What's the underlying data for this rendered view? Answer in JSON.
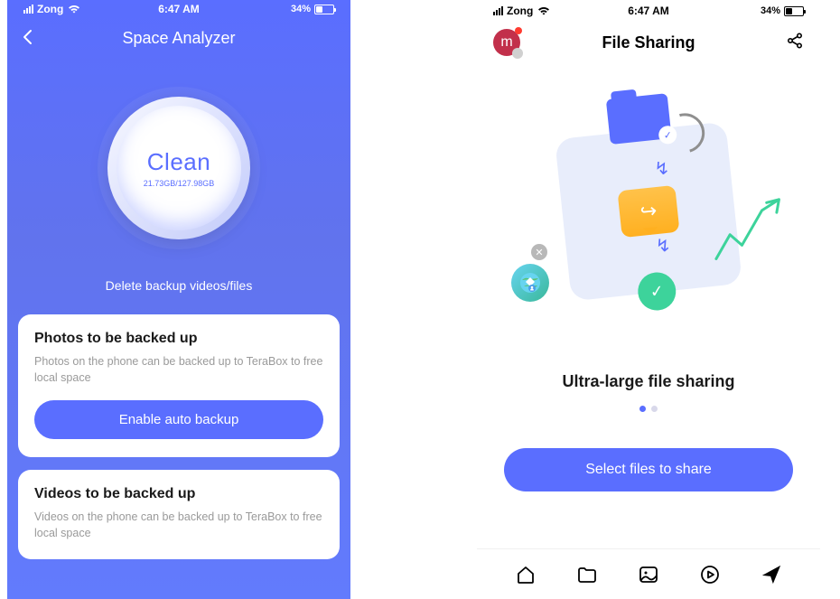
{
  "status": {
    "carrier": "Zong",
    "time": "6:47 AM",
    "battery_pct": "34%"
  },
  "left_screen": {
    "title": "Space Analyzer",
    "clean_label": "Clean",
    "storage": "21.73GB/127.98GB",
    "delete_text": "Delete backup videos/files",
    "cards": [
      {
        "title": "Photos to be backed up",
        "desc": "Photos on the phone can be backed up to TeraBox to free local space",
        "button": "Enable auto backup"
      },
      {
        "title": "Videos to be backed up",
        "desc": "Videos on the phone can be backed up to TeraBox to free local space"
      }
    ]
  },
  "right_screen": {
    "title": "File Sharing",
    "avatar_letter": "m",
    "headline": "Ultra-large file sharing",
    "select_button": "Select files to share"
  }
}
